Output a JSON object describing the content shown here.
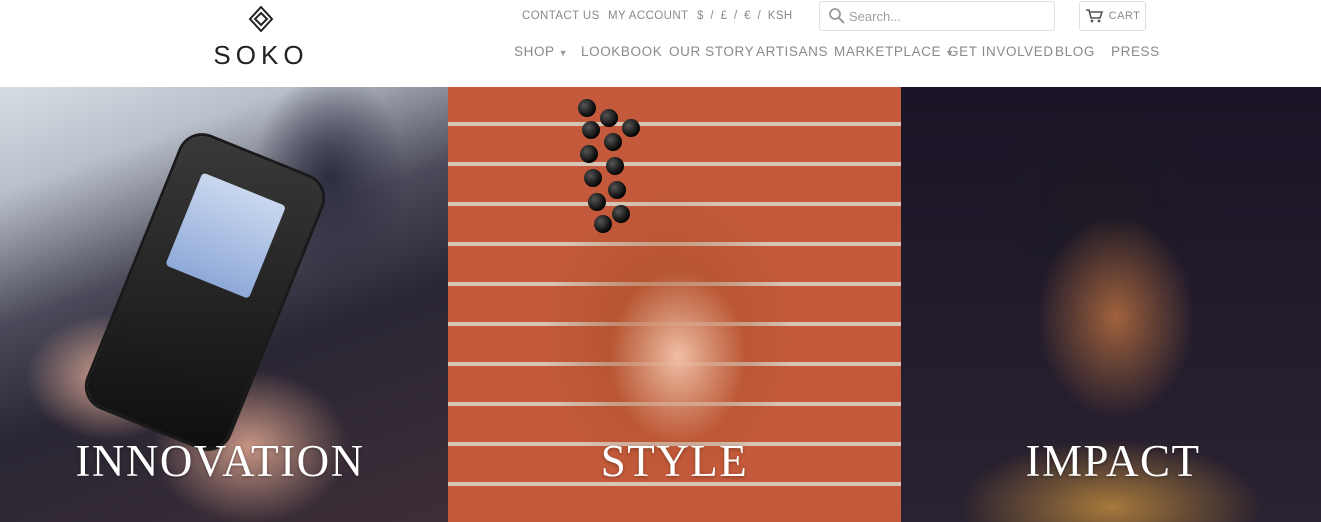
{
  "brand": {
    "name": "SOKO"
  },
  "utility": {
    "contact_label": "CONTACT US",
    "account_label": "MY ACCOUNT",
    "currencies": "$ / £ / € / KSH"
  },
  "search": {
    "placeholder": "Search..."
  },
  "cart": {
    "label": "CART"
  },
  "nav": {
    "shop": "SHOP",
    "lookbook": "LOOKBOOK",
    "our_story": "OUR STORY",
    "artisans": "ARTISANS",
    "marketplace": "MARKETPLACE",
    "get_involved": "GET INVOLVED",
    "blog": "BLOG",
    "press": "PRESS"
  },
  "hero": {
    "panels": [
      {
        "label": "INNOVATION"
      },
      {
        "label": "STYLE"
      },
      {
        "label": "IMPACT"
      }
    ]
  },
  "colors": {
    "text_muted": "#8a8a8a",
    "logo": "#222222",
    "border": "#e0e0e0",
    "hero_text": "#ffffff"
  },
  "icons": {
    "logo_mark": "diamond-logo-icon",
    "search": "search-icon",
    "cart": "cart-icon",
    "dropdown": "chevron-down-icon"
  }
}
